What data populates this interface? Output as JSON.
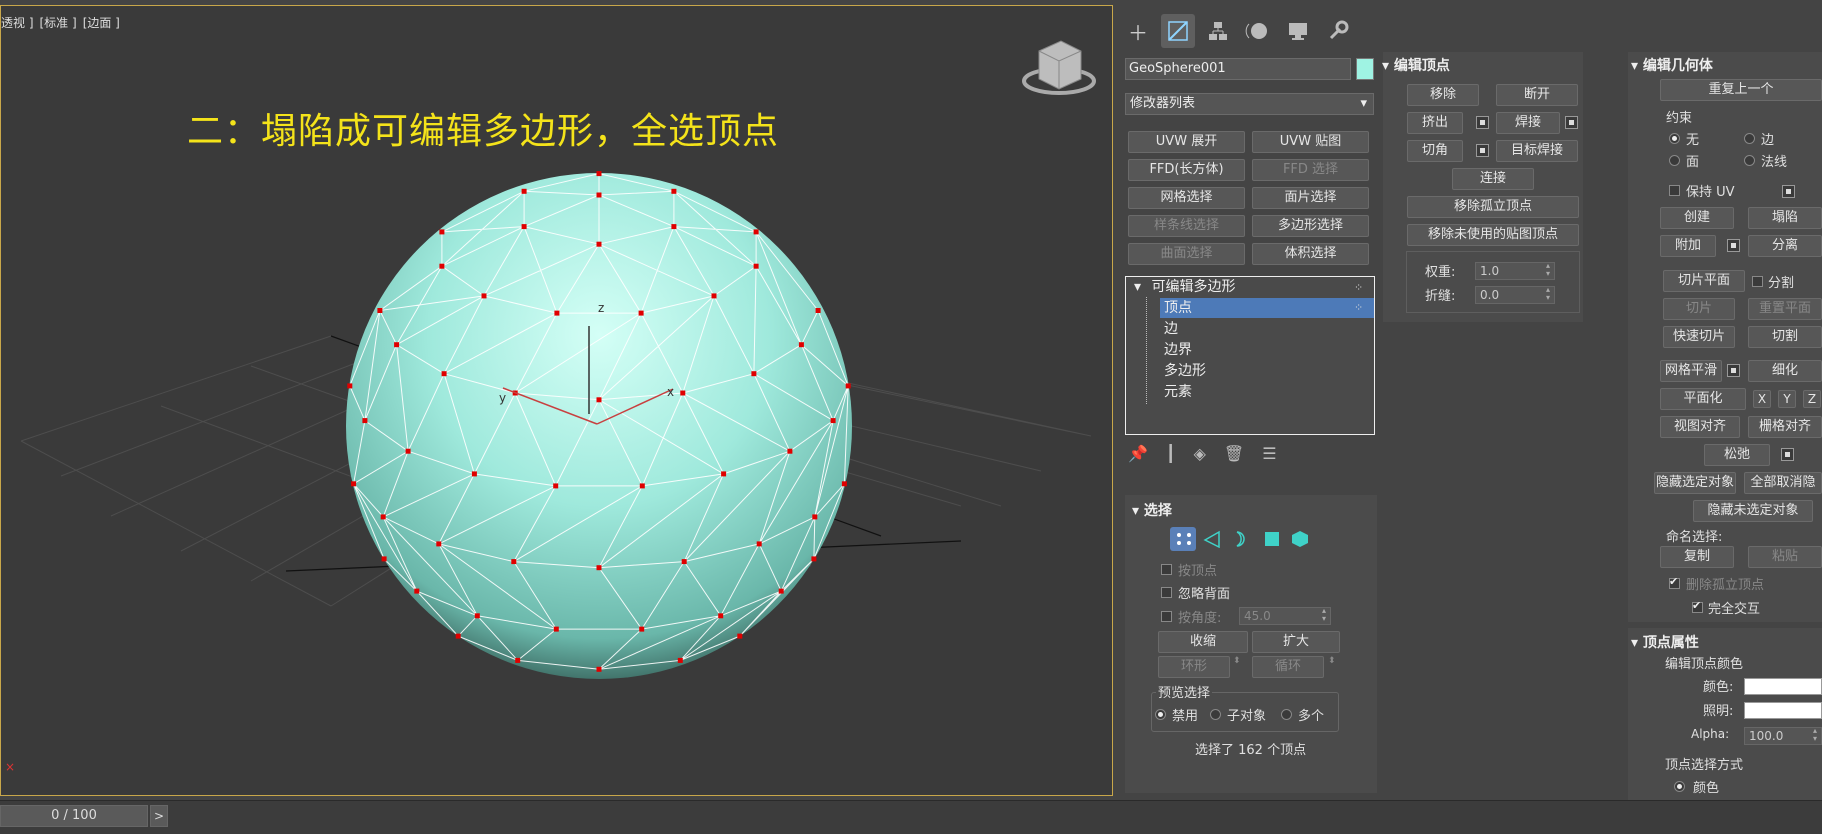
{
  "viewport": {
    "labels": [
      "透视 ]",
      "[标准 ]",
      "[边面 ]"
    ],
    "title": "二：塌陷成可编辑多边形，全选顶点",
    "axis_x": "x",
    "axis_y": "y",
    "axis_z": "z"
  },
  "timebar": {
    "frame": "0 / 100",
    "arrow": ">"
  },
  "tabs": [
    "create-icon",
    "modify-icon",
    "hierarchy-icon",
    "motion-icon",
    "display-icon",
    "utilities-icon"
  ],
  "object": {
    "name": "GeoSphere001",
    "color": "#9ff3e3"
  },
  "modifier_list": "修改器列表",
  "modifier_buttons": [
    [
      "UVW 展开",
      "UVW 贴图"
    ],
    [
      "FFD(长方体)",
      "FFD 选择"
    ],
    [
      "网格选择",
      "面片选择"
    ],
    [
      "样条线选择",
      "多边形选择"
    ],
    [
      "曲面选择",
      "体积选择"
    ]
  ],
  "stack": {
    "root": "可编辑多边形",
    "items": [
      "顶点",
      "边",
      "边界",
      "多边形",
      "元素"
    ],
    "selected_index": 0
  },
  "selection": {
    "header": "选择",
    "by_vertex": "按顶点",
    "ignore_back": "忽略背面",
    "by_angle": "按角度:",
    "angle_value": "45.0",
    "shrink": "收缩",
    "grow": "扩大",
    "ring": "环形",
    "loop": "循环",
    "preview_header": "预览选择",
    "preview_off": "禁用",
    "preview_sub": "子对象",
    "preview_multi": "多个",
    "status": "选择了 162 个顶点"
  },
  "edit_vertices": {
    "header": "编辑顶点",
    "remove": "移除",
    "break": "断开",
    "extrude": "挤出",
    "weld": "焊接",
    "chamfer": "切角",
    "target_weld": "目标焊接",
    "connect": "连接",
    "remove_isolated": "移除孤立顶点",
    "remove_unused": "移除未使用的贴图顶点",
    "weight_label": "权重:",
    "weight_value": "1.0",
    "crease_label": "折缝:",
    "crease_value": "0.0"
  },
  "edit_geometry": {
    "header": "编辑几何体",
    "repeat": "重复上一个",
    "constraint": "约束",
    "c_none": "无",
    "c_edge": "边",
    "c_face": "面",
    "c_normal": "法线",
    "keep_uv": "保持 UV",
    "create": "创建",
    "collapse": "塌陷",
    "attach": "附加",
    "detach": "分离",
    "slice_plane": "切片平面",
    "split": "分割",
    "slice": "切片",
    "reset_plane": "重置平面",
    "quickslice": "快速切片",
    "cut": "切割",
    "meshsmooth": "网格平滑",
    "tessellate": "细化",
    "make_planar": "平面化",
    "x": "X",
    "y": "Y",
    "z": "Z",
    "view_align": "视图对齐",
    "grid_align": "栅格对齐",
    "relax": "松弛",
    "hide_sel": "隐藏选定对象",
    "unhide_all": "全部取消隐",
    "hide_unsel": "隐藏未选定对象",
    "named_sel": "命名选择:",
    "copy": "复制",
    "paste": "粘贴",
    "delete_iso": "删除孤立顶点",
    "full_interact": "完全交互"
  },
  "vertex_props": {
    "header": "顶点属性",
    "edit_color": "编辑顶点颜色",
    "color": "颜色:",
    "illum": "照明:",
    "alpha": "Alpha:",
    "alpha_value": "100.0",
    "sel_by": "顶点选择方式",
    "by_color": "颜色"
  }
}
